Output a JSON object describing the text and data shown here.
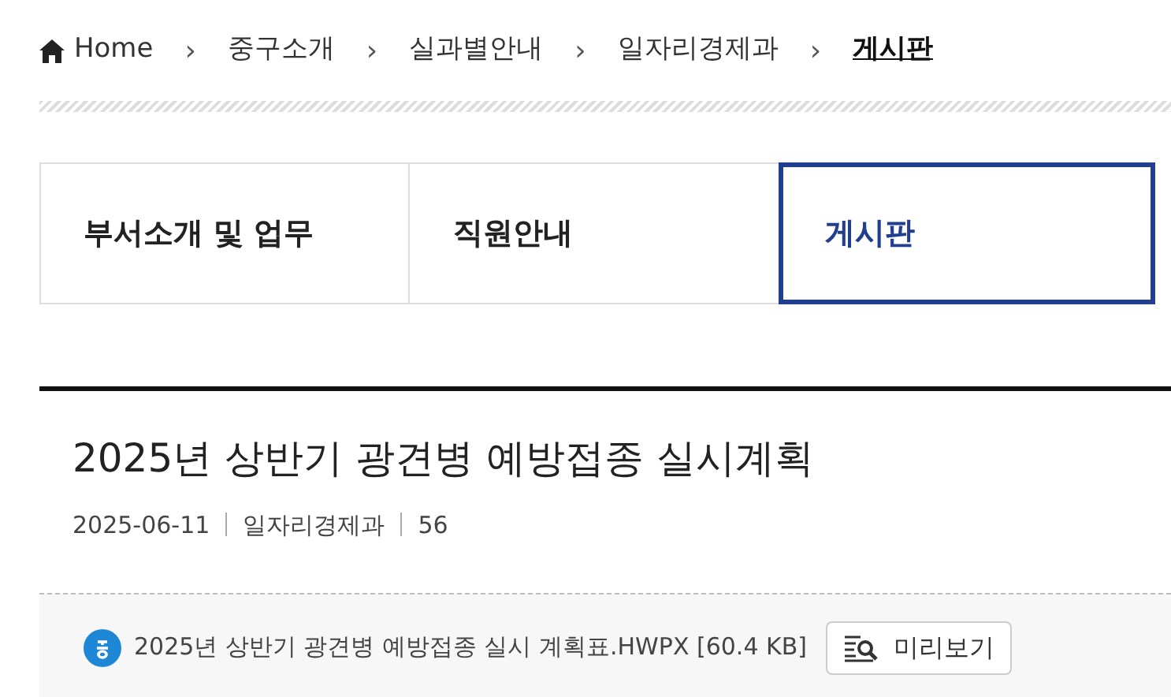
{
  "breadcrumb": [
    {
      "label": "Home",
      "kind": "home",
      "current": false
    },
    {
      "label": "중구소개",
      "kind": "link",
      "current": false
    },
    {
      "label": "실과별안내",
      "kind": "link",
      "current": false
    },
    {
      "label": "일자리경제과",
      "kind": "link",
      "current": false
    },
    {
      "label": "게시판",
      "kind": "link",
      "current": true
    }
  ],
  "breadcrumb_separator": "›",
  "tabs": [
    {
      "label": "부서소개 및 업무",
      "selected": false
    },
    {
      "label": "직원안내",
      "selected": false
    },
    {
      "label": "게시판",
      "selected": true
    }
  ],
  "post": {
    "title": "2025년 상반기 광견병 예방접종 실시계획",
    "date": "2025-06-11",
    "department": "일자리경제과",
    "views": "56"
  },
  "attachments": [
    {
      "file": "2025년 상반기 광견병 예방접종 실시 계획표.HWPX [60.4 KB]",
      "preview_label": "미리보기"
    }
  ]
}
